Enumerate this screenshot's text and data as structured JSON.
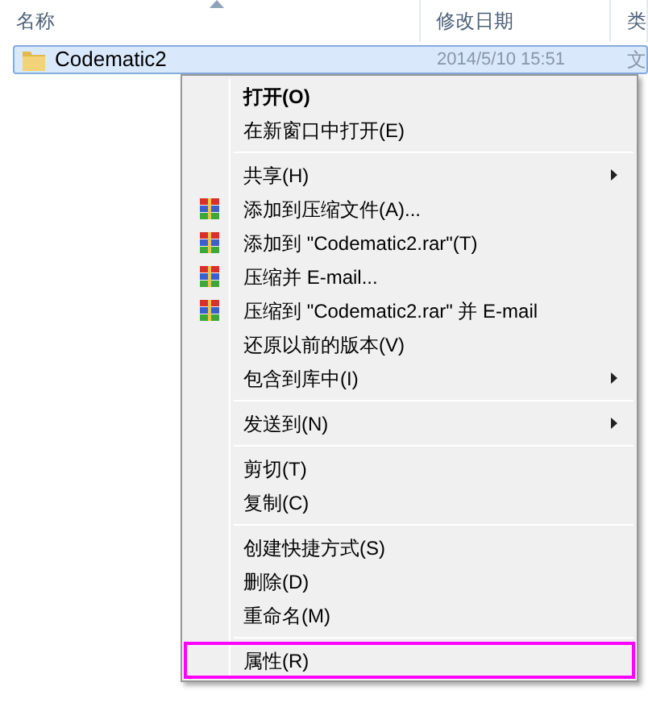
{
  "columns": [
    {
      "label": "名称",
      "sorted": true
    },
    {
      "label": "修改日期",
      "sorted": false
    },
    {
      "label": "类",
      "sorted": false
    }
  ],
  "file": {
    "name": "Codematic2",
    "date": "2014/5/10 15:51",
    "type": "文",
    "selected": true
  },
  "menu": {
    "items": [
      {
        "kind": "item",
        "label": "打开(O)",
        "bold": true,
        "archive_icon": false,
        "submenu": false,
        "highlighted": false
      },
      {
        "kind": "item",
        "label": "在新窗口中打开(E)",
        "bold": false,
        "archive_icon": false,
        "submenu": false,
        "highlighted": false
      },
      {
        "kind": "separator"
      },
      {
        "kind": "item",
        "label": "共享(H)",
        "bold": false,
        "archive_icon": false,
        "submenu": true,
        "highlighted": false
      },
      {
        "kind": "item",
        "label": "添加到压缩文件(A)...",
        "bold": false,
        "archive_icon": true,
        "submenu": false,
        "highlighted": false
      },
      {
        "kind": "item",
        "label": "添加到 \"Codematic2.rar\"(T)",
        "bold": false,
        "archive_icon": true,
        "submenu": false,
        "highlighted": false
      },
      {
        "kind": "item",
        "label": "压缩并 E-mail...",
        "bold": false,
        "archive_icon": true,
        "submenu": false,
        "highlighted": false
      },
      {
        "kind": "item",
        "label": "压缩到 \"Codematic2.rar\" 并 E-mail",
        "bold": false,
        "archive_icon": true,
        "submenu": false,
        "highlighted": false
      },
      {
        "kind": "item",
        "label": "还原以前的版本(V)",
        "bold": false,
        "archive_icon": false,
        "submenu": false,
        "highlighted": false
      },
      {
        "kind": "item",
        "label": "包含到库中(I)",
        "bold": false,
        "archive_icon": false,
        "submenu": true,
        "highlighted": false
      },
      {
        "kind": "separator"
      },
      {
        "kind": "item",
        "label": "发送到(N)",
        "bold": false,
        "archive_icon": false,
        "submenu": true,
        "highlighted": false
      },
      {
        "kind": "separator"
      },
      {
        "kind": "item",
        "label": "剪切(T)",
        "bold": false,
        "archive_icon": false,
        "submenu": false,
        "highlighted": false
      },
      {
        "kind": "item",
        "label": "复制(C)",
        "bold": false,
        "archive_icon": false,
        "submenu": false,
        "highlighted": false
      },
      {
        "kind": "separator"
      },
      {
        "kind": "item",
        "label": "创建快捷方式(S)",
        "bold": false,
        "archive_icon": false,
        "submenu": false,
        "highlighted": false
      },
      {
        "kind": "item",
        "label": "删除(D)",
        "bold": false,
        "archive_icon": false,
        "submenu": false,
        "highlighted": false
      },
      {
        "kind": "item",
        "label": "重命名(M)",
        "bold": false,
        "archive_icon": false,
        "submenu": false,
        "highlighted": false
      },
      {
        "kind": "separator"
      },
      {
        "kind": "item",
        "label": "属性(R)",
        "bold": false,
        "archive_icon": false,
        "submenu": false,
        "highlighted": true
      }
    ]
  }
}
